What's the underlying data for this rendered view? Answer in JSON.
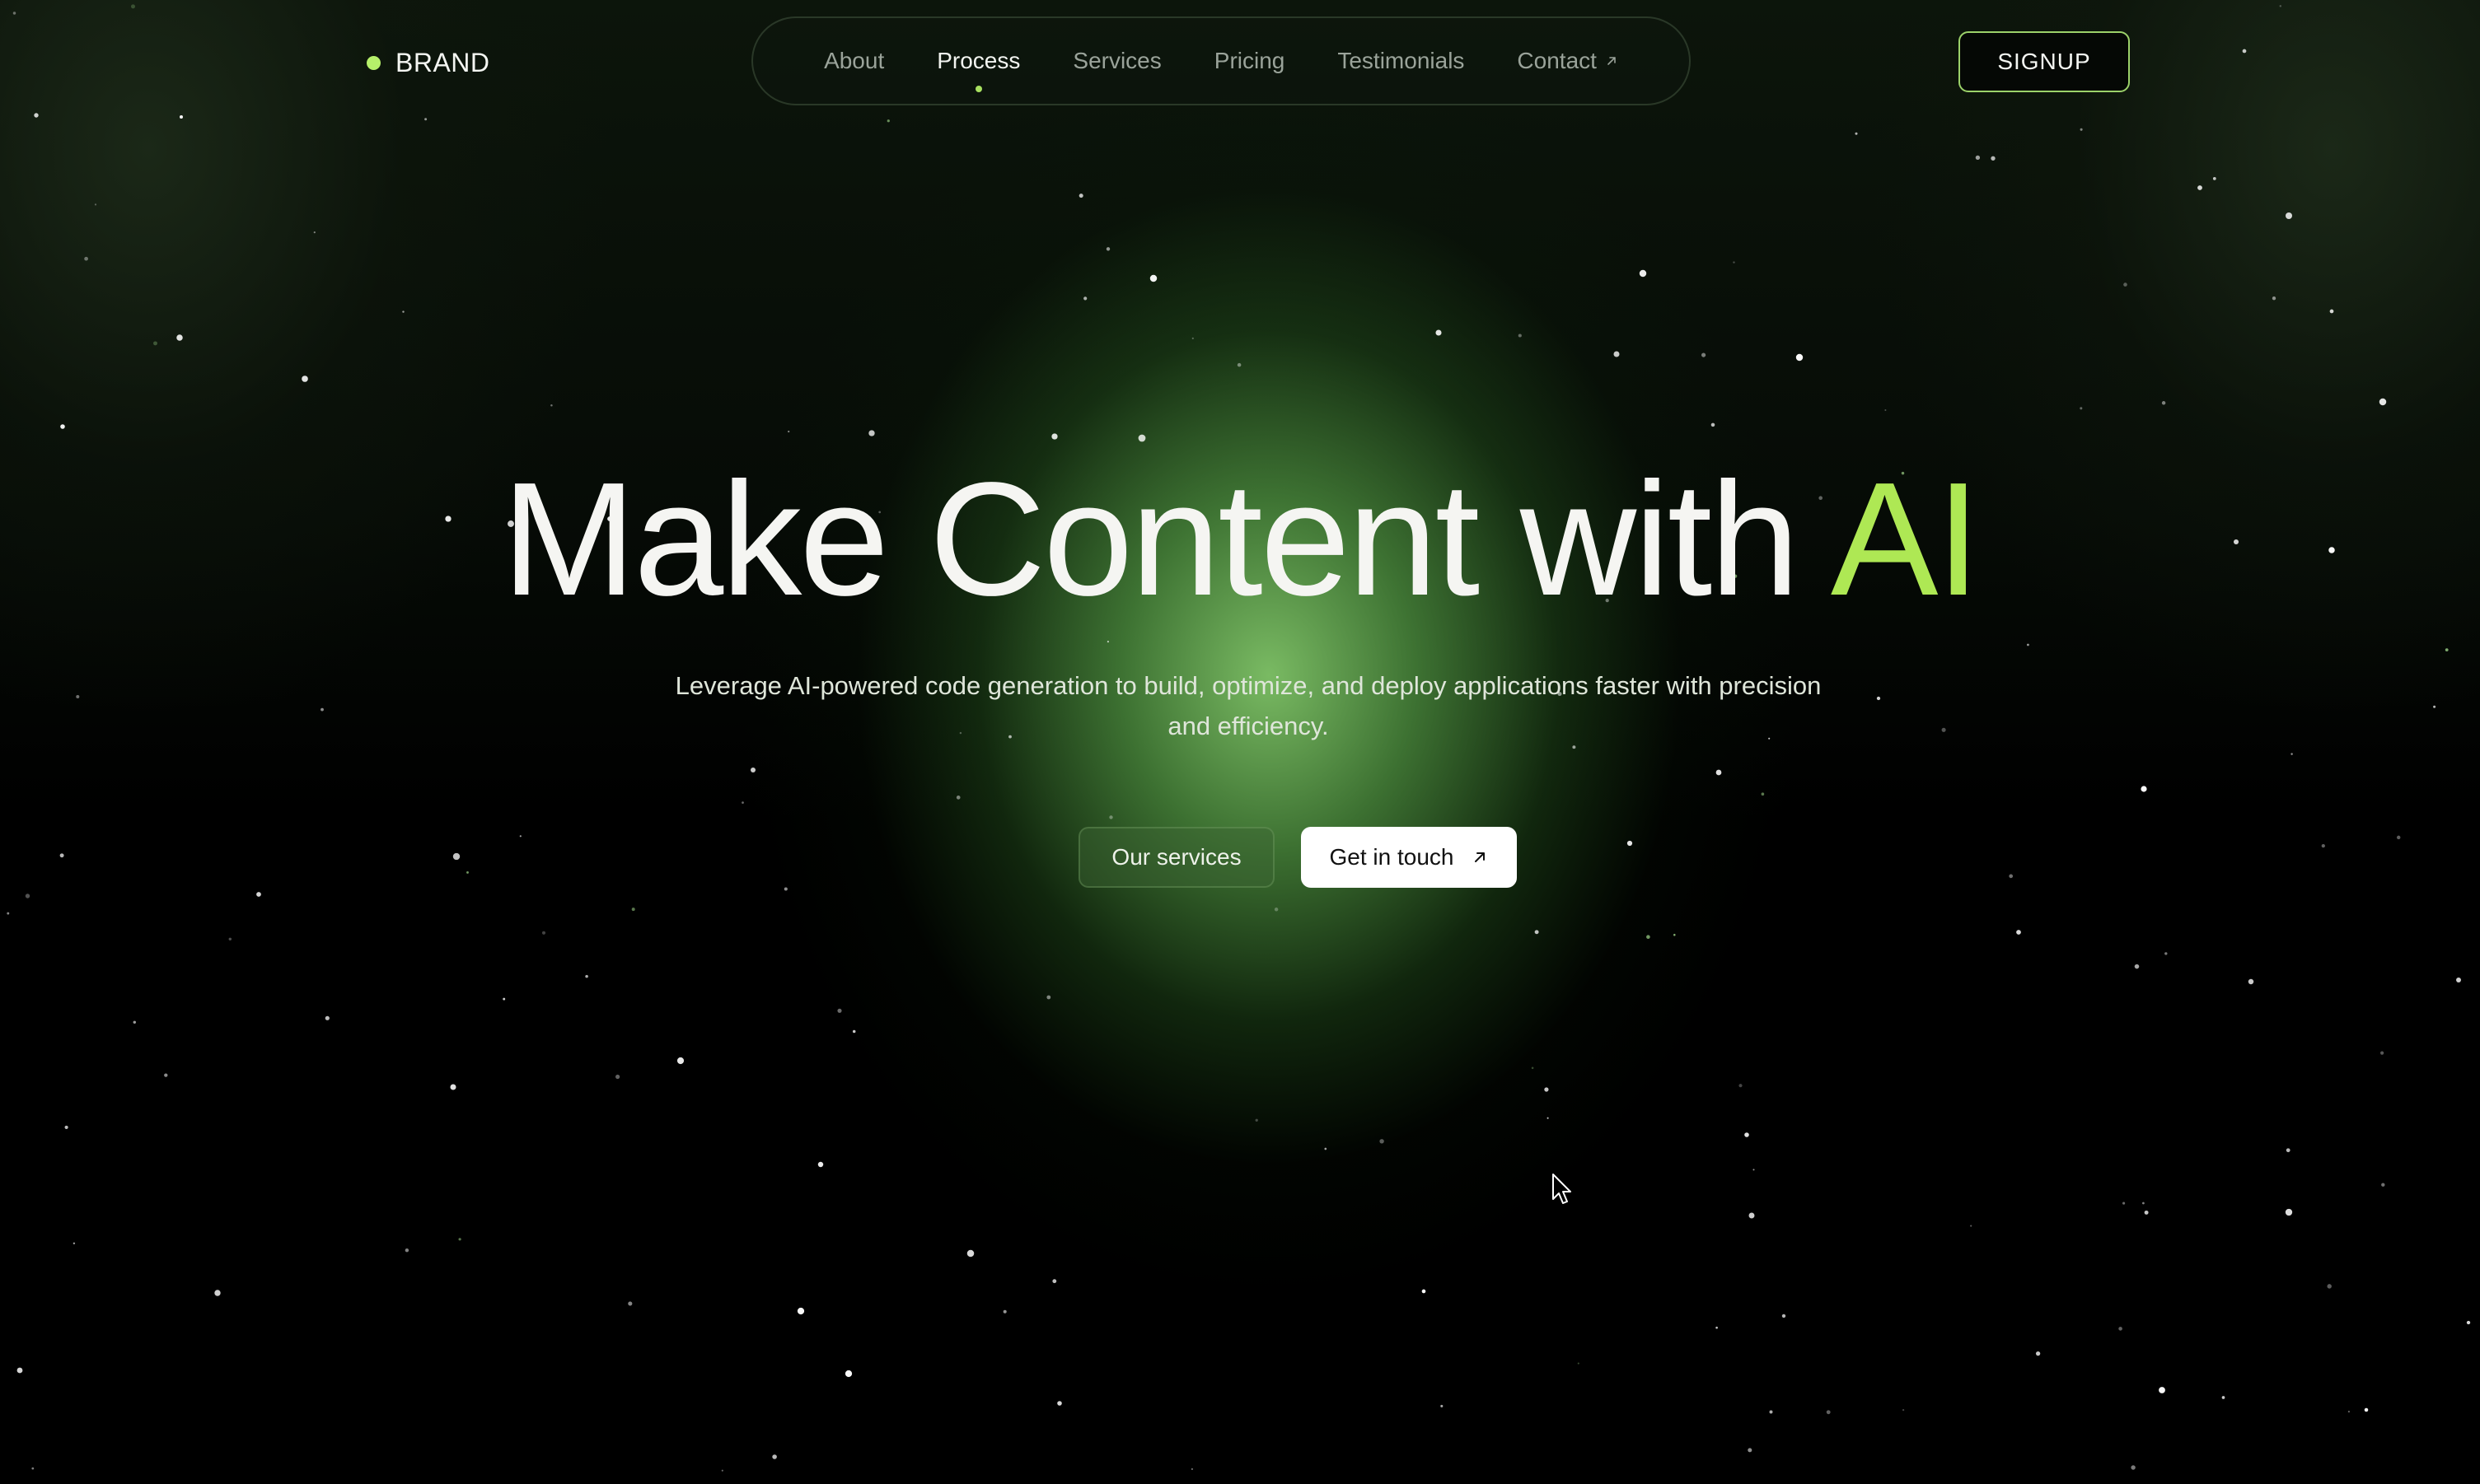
{
  "brand": {
    "name": "BRAND",
    "dot_color": "#b6f06a"
  },
  "nav": {
    "items": [
      {
        "label": "About",
        "active": false
      },
      {
        "label": "Process",
        "active": true
      },
      {
        "label": "Services",
        "active": false
      },
      {
        "label": "Pricing",
        "active": false
      },
      {
        "label": "Testimonials",
        "active": false
      },
      {
        "label": "Contact",
        "active": false,
        "icon": "arrow-up-right-icon"
      }
    ]
  },
  "signup": {
    "label": "SIGNUP"
  },
  "hero": {
    "title_main": "Make Content with ",
    "title_accent": "AI",
    "accent_color": "#aee854",
    "subtitle": "Leverage AI-powered code generation to build, optimize, and deploy applications faster with precision and efficiency.",
    "buttons": {
      "secondary": "Our services",
      "primary": "Get in touch",
      "primary_icon": "arrow-up-right-icon"
    }
  },
  "colors": {
    "background": "#000000",
    "glow": "#80c468",
    "accent": "#aee854"
  }
}
